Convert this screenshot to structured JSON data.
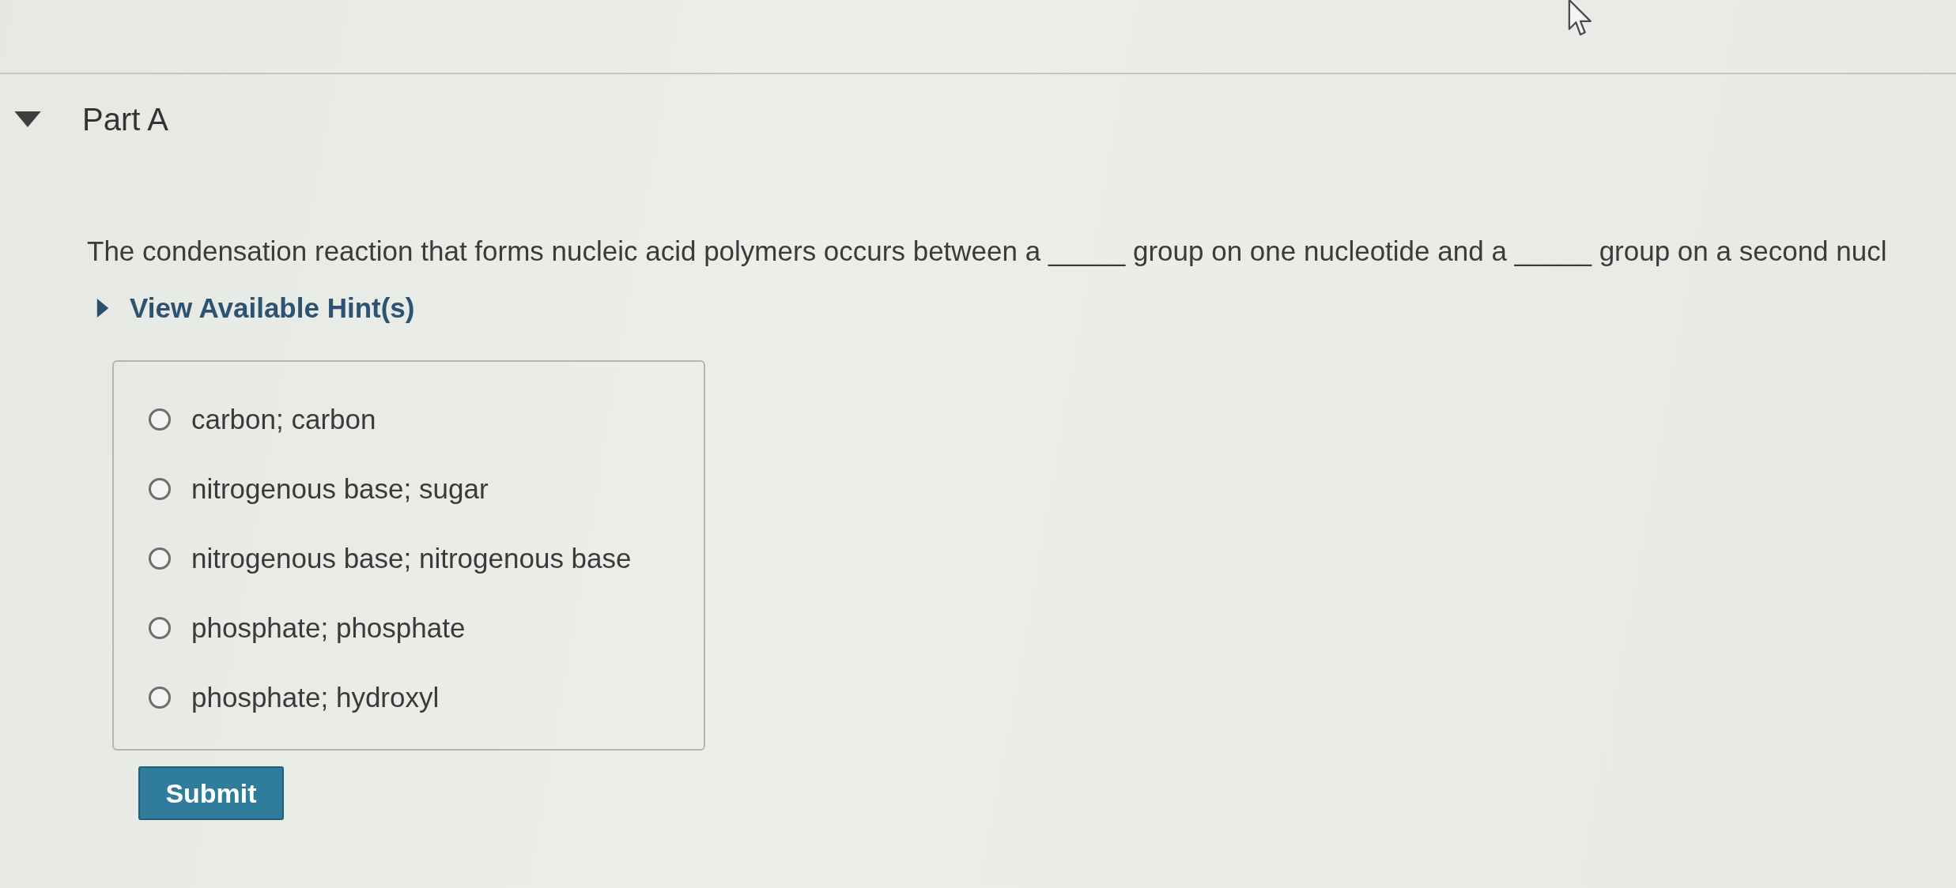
{
  "part": {
    "title": "Part A",
    "expanded": true
  },
  "question": {
    "text": "The condensation reaction that forms nucleic acid polymers occurs between a _____ group on one nucleotide and a _____ group on a second nucl"
  },
  "hint": {
    "label": "View Available Hint(s)",
    "expanded": false
  },
  "options": [
    {
      "label": "carbon; carbon",
      "selected": false
    },
    {
      "label": "nitrogenous base; sugar",
      "selected": false
    },
    {
      "label": "nitrogenous base; nitrogenous base",
      "selected": false
    },
    {
      "label": "phosphate; phosphate",
      "selected": false
    },
    {
      "label": "phosphate; hydroxyl",
      "selected": false
    }
  ],
  "submit": {
    "label": "Submit"
  }
}
